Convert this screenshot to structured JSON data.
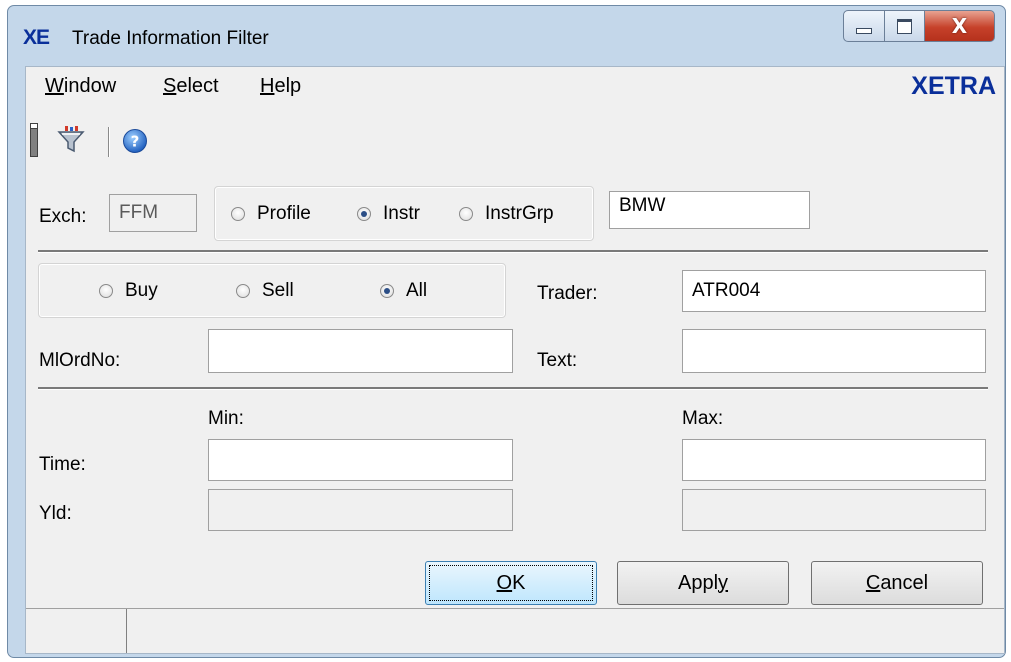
{
  "window": {
    "app_logo": "XE",
    "title": "Trade Information Filter",
    "close_glyph": "X"
  },
  "menu": {
    "items": [
      {
        "first": "W",
        "rest": "indow"
      },
      {
        "first": "S",
        "rest": "elect"
      },
      {
        "first": "H",
        "rest": "elp"
      }
    ],
    "brand": "XETRA"
  },
  "toolbar": {
    "icons": [
      "filter-icon",
      "help-icon"
    ]
  },
  "exchange": {
    "label": "Exch:",
    "value": "FFM"
  },
  "scope": {
    "options": [
      "Profile",
      "Instr",
      "InstrGrp"
    ],
    "selected": "Instr",
    "value": "BMW"
  },
  "side": {
    "options": [
      "Buy",
      "Sell",
      "All"
    ],
    "selected": "All"
  },
  "trader": {
    "label": "Trader:",
    "value": "ATR004"
  },
  "mlordno": {
    "label": "MlOrdNo:",
    "value": ""
  },
  "text": {
    "label": "Text:",
    "value": ""
  },
  "range": {
    "min_label": "Min:",
    "max_label": "Max:",
    "time_label": "Time:",
    "yld_label": "Yld:"
  },
  "buttons": {
    "ok": {
      "u": "O",
      "rest": "K"
    },
    "apply": {
      "pre": "Appl",
      "u": "y"
    },
    "cancel": {
      "u": "C",
      "rest": "ancel"
    }
  },
  "status": [
    "",
    ""
  ]
}
